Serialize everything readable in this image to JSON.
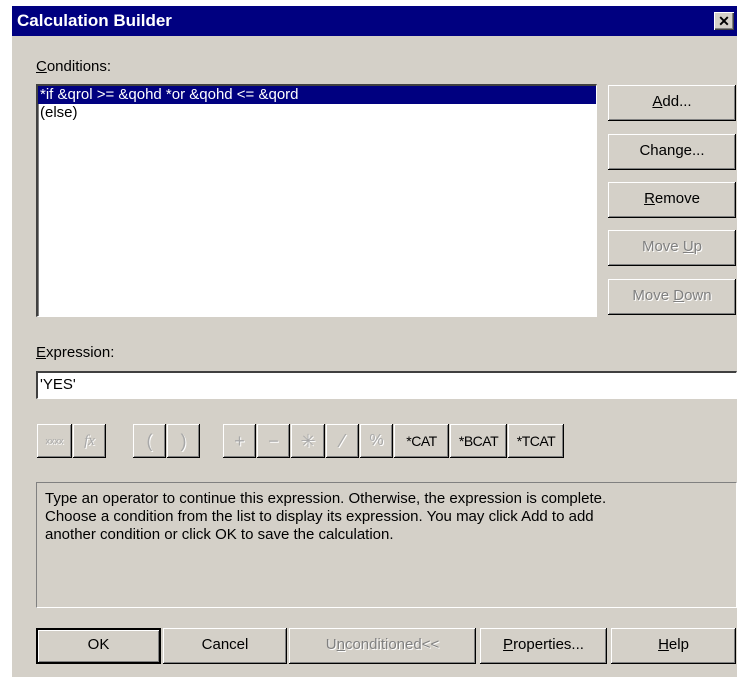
{
  "window": {
    "title": "Calculation Builder",
    "close_glyph": "✕"
  },
  "conditions": {
    "label_prefix": "",
    "label_mnemonic": "C",
    "label_rest": "onditions:",
    "items": [
      "*if &qrol >= &qohd *or &qohd <= &qord",
      "(else)"
    ],
    "selected_index": 0
  },
  "side_buttons": {
    "add": {
      "mnemonic": "A",
      "rest": "dd..."
    },
    "change": {
      "label": "Change..."
    },
    "remove": {
      "mnemonic": "R",
      "rest": "emove"
    },
    "move_up": {
      "pre": "Move ",
      "mnemonic": "U",
      "rest": "p"
    },
    "move_down": {
      "pre": "Move ",
      "mnemonic": "D",
      "rest": "own"
    }
  },
  "expression": {
    "label_mnemonic": "E",
    "label_rest": "xpression:",
    "value": "'YES'"
  },
  "toolbar": {
    "field_glyph": "xxxx",
    "function_glyph": "fx",
    "open_paren": "(",
    "close_paren": ")",
    "plus": "+",
    "minus": "−",
    "multiply": "✳",
    "divide": "⁄",
    "percent": "%",
    "cat": "*CAT",
    "bcat": "*BCAT",
    "tcat": "*TCAT"
  },
  "info": {
    "line1": "Type an operator to continue this expression.  Otherwise, the expression is complete.",
    "line2": "Choose a condition from the list to display its expression.  You may click Add to add",
    "line3": "another condition or click OK to save the calculation."
  },
  "bottom_buttons": {
    "ok": "OK",
    "cancel": "Cancel",
    "unconditioned": {
      "pre": "U",
      "mnemonic": "n",
      "rest": "conditioned<<"
    },
    "properties": {
      "mnemonic": "P",
      "rest": "roperties..."
    },
    "help": {
      "mnemonic": "H",
      "rest": "elp"
    }
  }
}
